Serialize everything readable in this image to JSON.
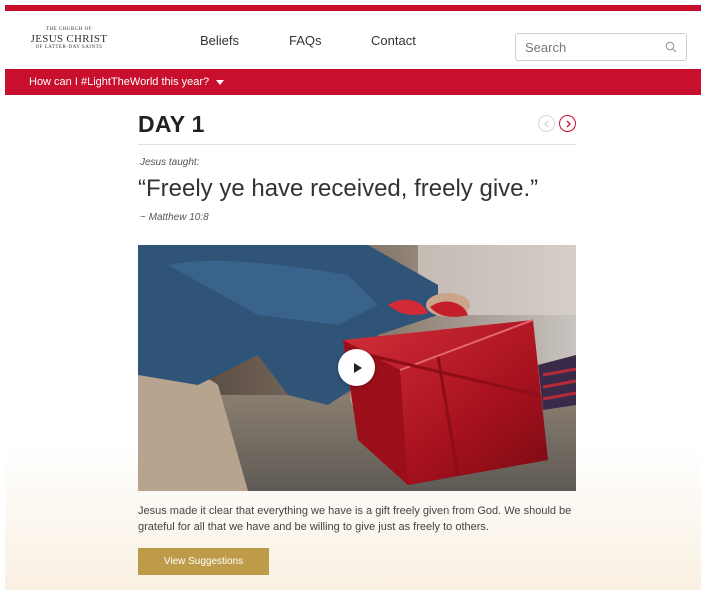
{
  "logo": {
    "line1": "THE CHURCH OF",
    "line2": "JESUS CHRIST",
    "line3": "OF LATTER-DAY SAINTS"
  },
  "nav": {
    "items": [
      {
        "label": "Beliefs"
      },
      {
        "label": "FAQs"
      },
      {
        "label": "Contact"
      }
    ]
  },
  "search": {
    "placeholder": "Search",
    "icon": "search-icon"
  },
  "banner": {
    "label": "How can I #LightTheWorld this year?",
    "icon": "caret-down-icon"
  },
  "main": {
    "day_title": "DAY 1",
    "prev_icon": "chevron-left-icon",
    "next_icon": "chevron-right-icon",
    "intro": "Jesus taught:",
    "quote": "“Freely ye have received, freely give.”",
    "reference": "~ Matthew 10:8",
    "video_icon": "play-icon",
    "description": "Jesus made it clear that everything we have is a gift freely given from God. We should be grateful for all that we have and be willing to give just as freely to others.",
    "cta_label": "View Suggestions"
  },
  "colors": {
    "brand_red": "#c8102e",
    "cta_gold": "#bd9b48",
    "text_dark": "#333333"
  }
}
